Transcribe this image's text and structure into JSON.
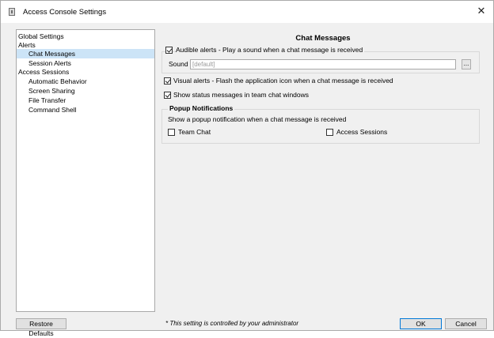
{
  "window": {
    "title": "Access Console Settings"
  },
  "nav": {
    "items": [
      {
        "label": "Global Settings",
        "level": 0,
        "selected": false
      },
      {
        "label": "Alerts",
        "level": 0,
        "selected": false
      },
      {
        "label": "Chat Messages",
        "level": 1,
        "selected": true
      },
      {
        "label": "Session Alerts",
        "level": 1,
        "selected": false
      },
      {
        "label": "Access Sessions",
        "level": 0,
        "selected": false
      },
      {
        "label": "Automatic Behavior",
        "level": 1,
        "selected": false
      },
      {
        "label": "Screen Sharing",
        "level": 1,
        "selected": false
      },
      {
        "label": "File Transfer",
        "level": 1,
        "selected": false
      },
      {
        "label": "Command Shell",
        "level": 1,
        "selected": false
      }
    ]
  },
  "content": {
    "title": "Chat Messages",
    "audible": {
      "label": "Audible alerts - Play a sound when a chat message is received",
      "checked": true
    },
    "sound": {
      "label": "Sound",
      "placeholder": "[default]",
      "browse_label": "..."
    },
    "visual": {
      "label": "Visual alerts - Flash the application icon when a chat message is received",
      "checked": true
    },
    "status": {
      "label": "Show status messages in team chat windows",
      "checked": true
    },
    "popup": {
      "heading": "Popup Notifications",
      "description": "Show a popup notification when a chat message is received",
      "team_chat": {
        "label": "Team Chat",
        "checked": false
      },
      "access_sessions": {
        "label": "Access Sessions",
        "checked": false
      }
    }
  },
  "footer": {
    "restore_label": "Restore Defaults",
    "admin_note": "* This setting is controlled by your administrator",
    "ok_label": "OK",
    "cancel_label": "Cancel"
  },
  "colors": {
    "selection": "#cce4f7",
    "default_button_border": "#0078d7"
  }
}
